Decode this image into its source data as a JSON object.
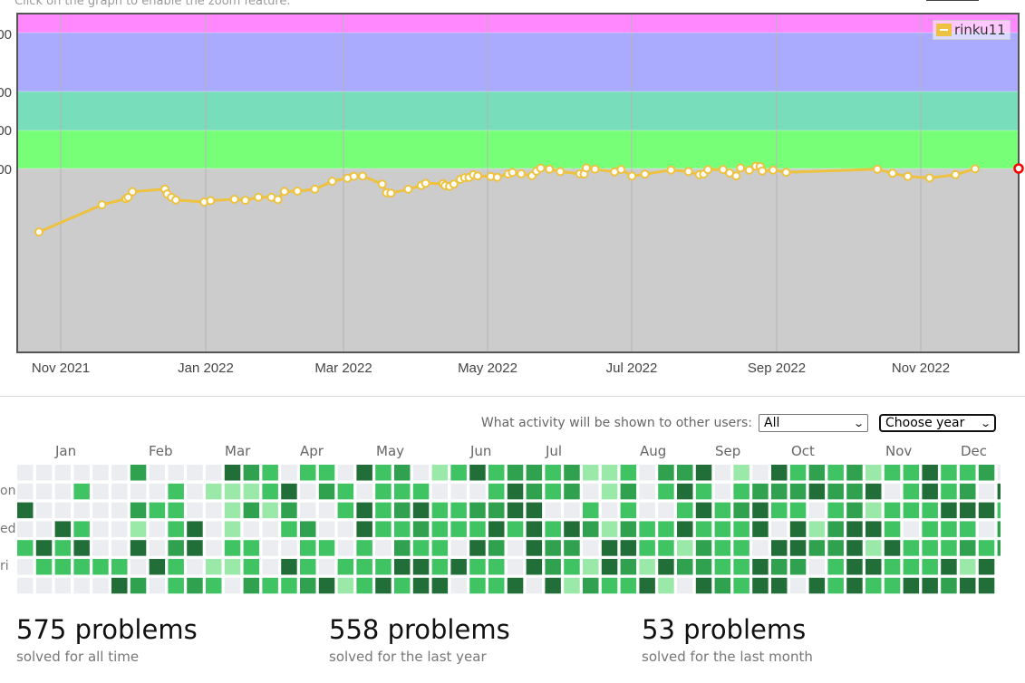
{
  "hint_text": "Click on the graph to enable the zoom feature.",
  "chart_data": {
    "type": "line",
    "y_tick_labels_visible": [
      "00",
      "00",
      "00",
      "00"
    ],
    "x_tick_labels": [
      "Nov 2021",
      "Jan 2022",
      "Mar 2022",
      "May 2022",
      "Jul 2022",
      "Sep 2022",
      "Nov 2022"
    ],
    "bands": [
      {
        "color": "#ff88ff"
      },
      {
        "color": "#aaaaff"
      },
      {
        "color": "#77ddbb"
      },
      {
        "color": "#77ff77"
      },
      {
        "color": "#cccccc"
      }
    ],
    "series": [
      {
        "name": "rinku11",
        "color": "#edc240",
        "last_point_marker": "#ff0000",
        "x": [
          "2021-10-22",
          "2021-11-20",
          "2021-12-01",
          "2021-12-02",
          "2021-12-04",
          "2021-12-19",
          "2021-12-20",
          "2021-12-22",
          "2021-12-24",
          "2022-01-06",
          "2022-01-09",
          "2022-01-20",
          "2022-01-25",
          "2022-01-31",
          "2022-02-06",
          "2022-02-09",
          "2022-02-12",
          "2022-02-18",
          "2022-02-26",
          "2022-03-06",
          "2022-03-13",
          "2022-03-16",
          "2022-03-20",
          "2022-03-29",
          "2022-03-31",
          "2022-04-02",
          "2022-04-10",
          "2022-04-16",
          "2022-04-18",
          "2022-04-26",
          "2022-04-27",
          "2022-04-29",
          "2022-05-01",
          "2022-05-04",
          "2022-05-06",
          "2022-05-08",
          "2022-05-10",
          "2022-05-12",
          "2022-05-18",
          "2022-05-21",
          "2022-05-26",
          "2022-05-28",
          "2022-06-01",
          "2022-06-06",
          "2022-06-08",
          "2022-06-10",
          "2022-06-14",
          "2022-06-19",
          "2022-06-28",
          "2022-06-30",
          "2022-07-01",
          "2022-07-05",
          "2022-07-14",
          "2022-07-17",
          "2022-07-22",
          "2022-07-28",
          "2022-08-09",
          "2022-08-17",
          "2022-08-22",
          "2022-08-24",
          "2022-08-26",
          "2022-09-02",
          "2022-09-05",
          "2022-09-08",
          "2022-09-10",
          "2022-09-14",
          "2022-09-17",
          "2022-09-19",
          "2022-09-20",
          "2022-09-25",
          "2022-10-01",
          "2022-11-12",
          "2022-11-19",
          "2022-11-26",
          "2022-12-06",
          "2022-12-18",
          "2022-12-27"
        ],
        "values": [
          1066,
          1209,
          1241,
          1248,
          1278,
          1292,
          1266,
          1248,
          1235,
          1224,
          1231,
          1238,
          1233,
          1249,
          1249,
          1236,
          1279,
          1281,
          1291,
          1333,
          1349,
          1359,
          1360,
          1318,
          1273,
          1270,
          1291,
          1311,
          1322,
          1320,
          1310,
          1306,
          1318,
          1343,
          1352,
          1353,
          1367,
          1361,
          1358,
          1354,
          1371,
          1379,
          1372,
          1362,
          1386,
          1402,
          1396,
          1384,
          1372,
          1371,
          1403,
          1396,
          1382,
          1395,
          1360,
          1370,
          1392,
          1384,
          1367,
          1371,
          1394,
          1395,
          1376,
          1361,
          1403,
          1391,
          1412,
          1410,
          1387,
          1392,
          1380,
          1396,
          1375,
          1358,
          1350,
          1367,
          1398
        ]
      }
    ]
  },
  "activity": {
    "label": "What activity will be shown to other users:",
    "visibility_value": "All",
    "year_value": "Choose year",
    "months": [
      "Jan",
      "Feb",
      "Mar",
      "Apr",
      "May",
      "Jun",
      "Jul",
      "Aug",
      "Sep",
      "Oct",
      "Nov",
      "Dec"
    ],
    "day_labels": [
      "on",
      "ed",
      "ri"
    ],
    "colors": [
      "#ebedf0",
      "#9be9a8",
      "#40c463",
      "#30a14e",
      "#216e39"
    ]
  },
  "stats": [
    {
      "value": "575 problems",
      "caption": "solved for all time"
    },
    {
      "value": "558 problems",
      "caption": "solved for the last year"
    },
    {
      "value": "53 problems",
      "caption": "solved for the last month"
    }
  ]
}
